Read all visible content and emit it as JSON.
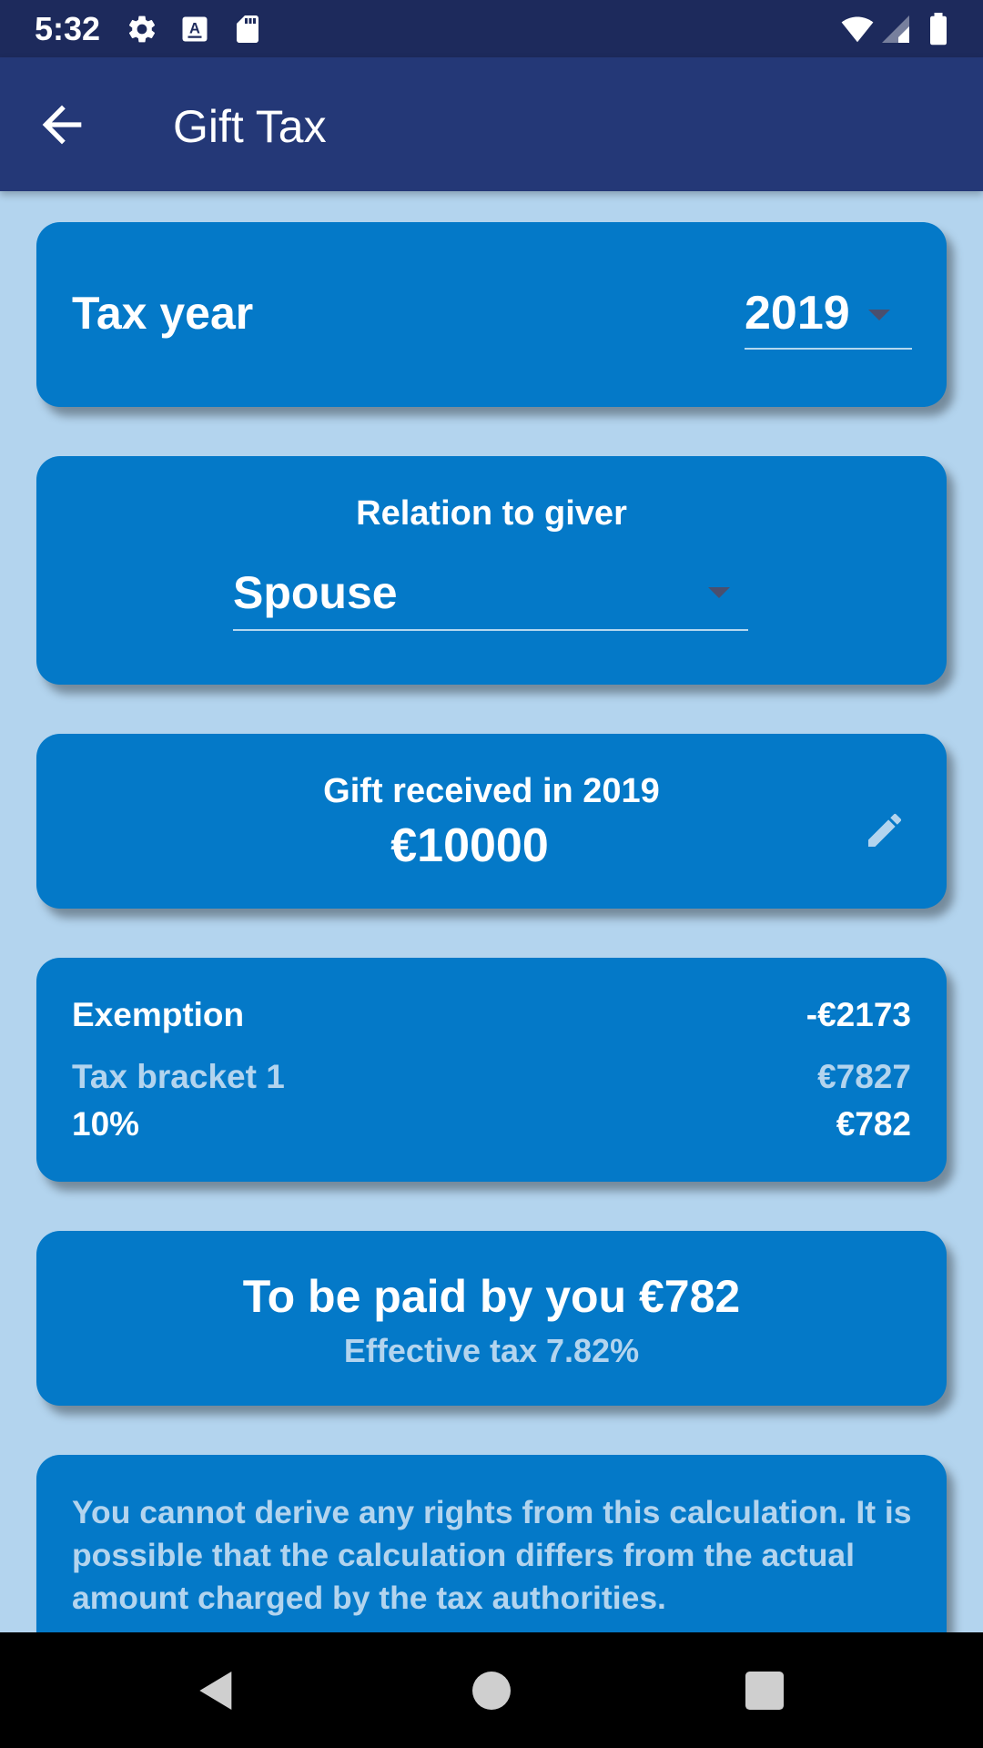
{
  "status_bar": {
    "time": "5:32",
    "icons": [
      "gear-icon",
      "font-download-icon",
      "sd-card-icon",
      "wifi-icon",
      "signal-icon",
      "battery-icon"
    ]
  },
  "app_bar": {
    "title": "Gift Tax",
    "back_icon": "arrow-back-icon"
  },
  "tax_year": {
    "label": "Tax year",
    "value": "2019"
  },
  "relation": {
    "label": "Relation to giver",
    "value": "Spouse"
  },
  "gift": {
    "label": "Gift received  in 2019",
    "amount": "€10000",
    "edit_icon": "pencil-icon"
  },
  "breakdown": {
    "exemption_label": "Exemption",
    "exemption_value": "-€2173",
    "bracket_label": "Tax bracket 1",
    "bracket_value": "€7827",
    "rate_label": "10%",
    "rate_value": "€782"
  },
  "total": {
    "main": "To be paid by you €782",
    "effective": "Effective tax 7.82%"
  },
  "disclaimer": {
    "text": "You cannot derive any rights from this calculation. It is possible that the calculation differs from the actual amount charged by the tax authorities."
  },
  "nav_bar": {
    "icons": [
      "back-triangle-icon",
      "home-circle-icon",
      "recents-square-icon"
    ]
  },
  "colors": {
    "status_bar": "#1d2a5c",
    "app_bar": "#243877",
    "background": "#b3d4ee",
    "card": "#0479c8",
    "muted_text": "#b3d4ee"
  }
}
